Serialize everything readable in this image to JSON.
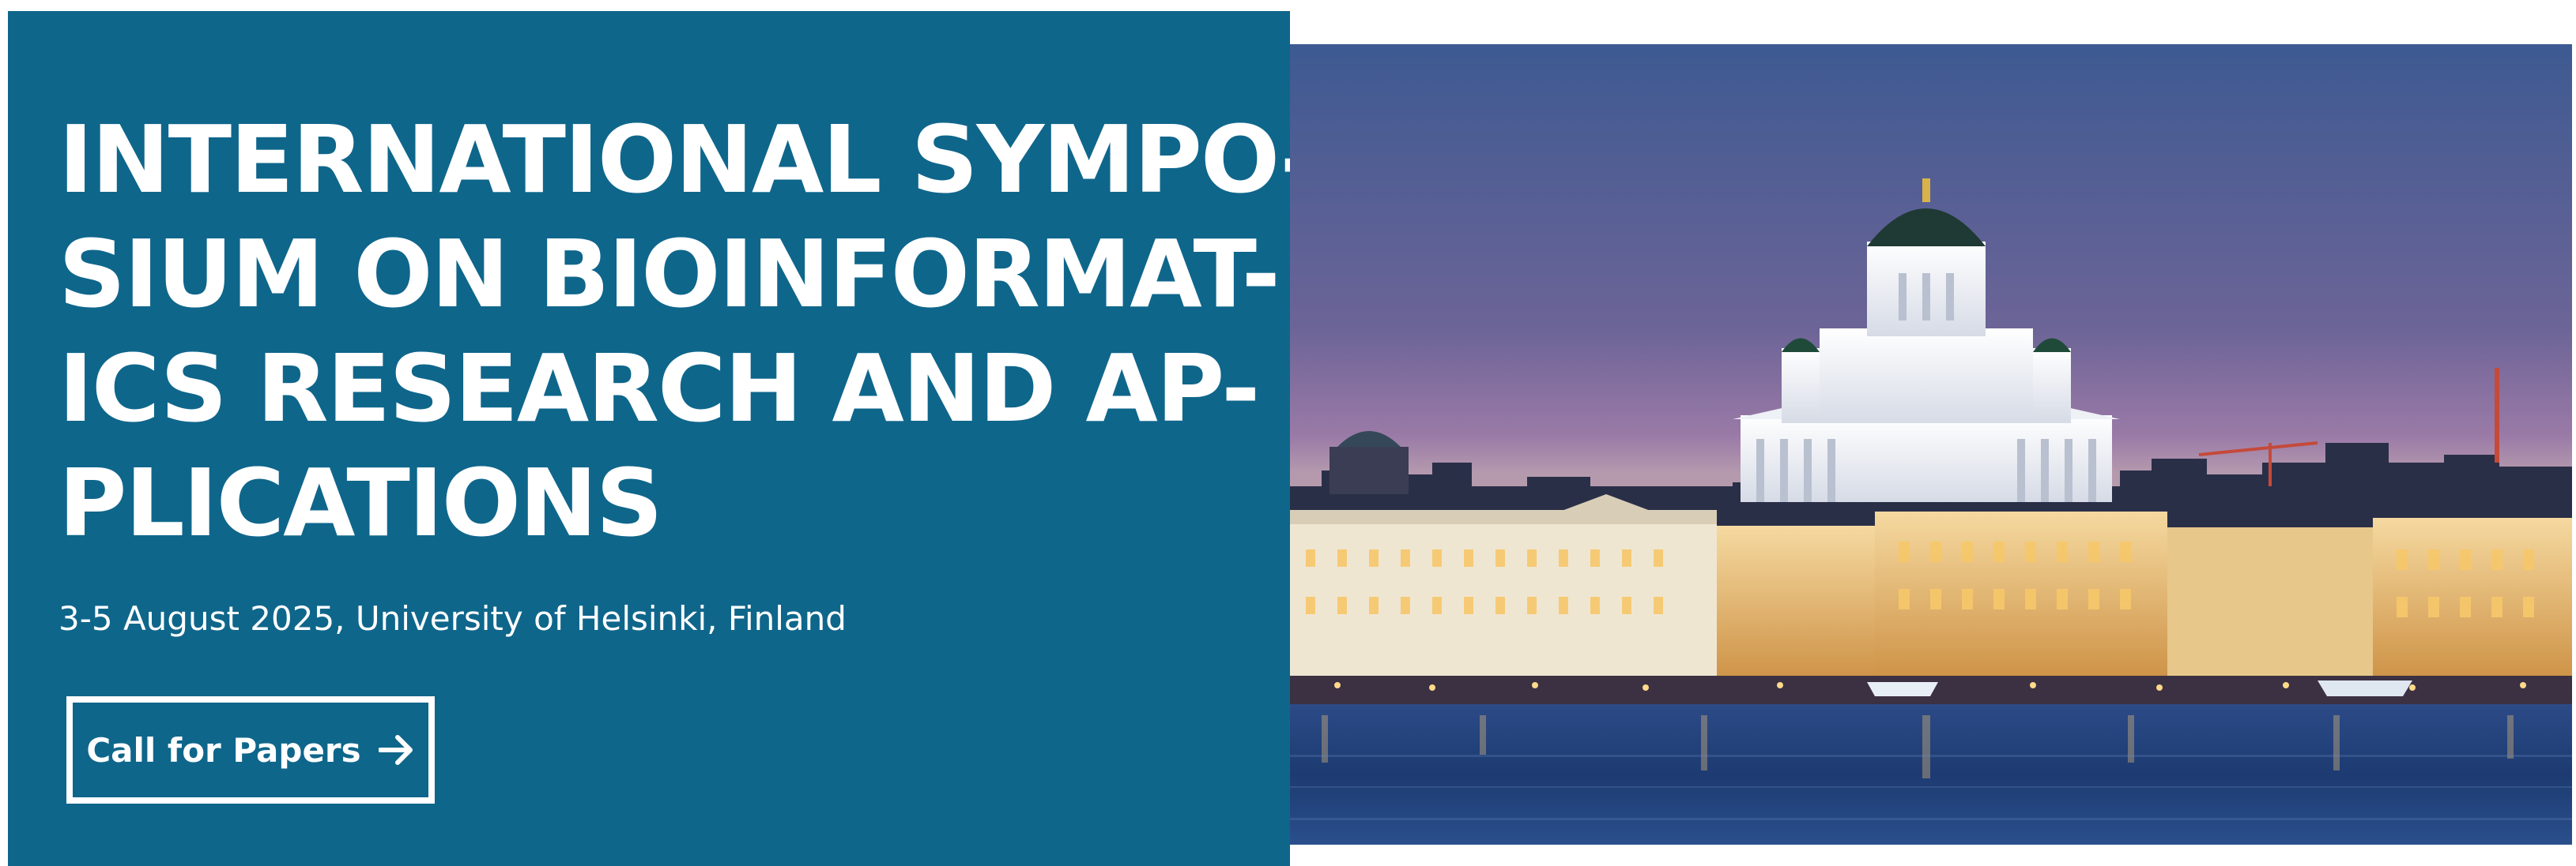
{
  "hero": {
    "title_lines": [
      "INTERNATIONAL SYMPO-",
      "SIUM ON BIOINFORMAT-",
      "ICS RESEARCH AND AP-",
      "PLICATIONS"
    ],
    "subtitle": "3-5 August 2025, University of Helsinki, Finland",
    "cta_label": "Call for Papers",
    "cta_icon": "arrow-right-icon",
    "image_alt": "Helsinki waterfront at dusk",
    "colors": {
      "panel": "#0f668b",
      "text": "#ffffff",
      "sky_top": "#3d5a92",
      "sky_bottom": "#9a7aa7",
      "water": "#1d3b72"
    }
  }
}
